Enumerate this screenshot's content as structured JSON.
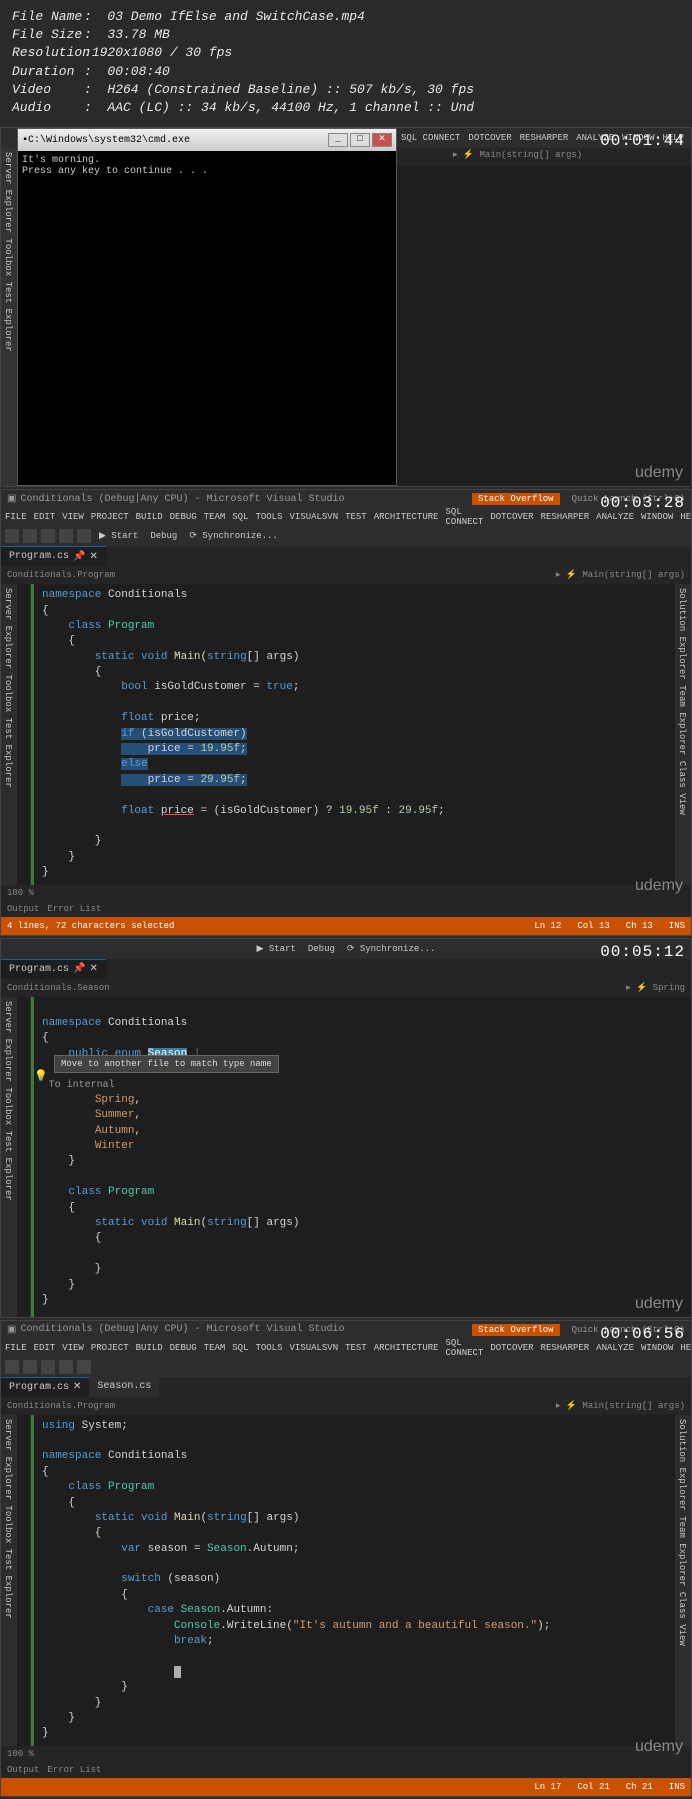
{
  "meta": {
    "file_name": {
      "label": "File Name",
      "value": "03 Demo IfElse and SwitchCase.mp4"
    },
    "file_size": {
      "label": "File Size",
      "value": "33.78 MB"
    },
    "resolution": {
      "label": "Resolution",
      "value": "1920x1080 / 30 fps"
    },
    "duration": {
      "label": "Duration",
      "value": "00:08:40"
    },
    "video": {
      "label": "Video",
      "value": "H264 (Constrained Baseline) :: 507 kb/s, 30 fps"
    },
    "audio": {
      "label": "Audio",
      "value": "AAC (LC) :: 34 kb/s, 44100 Hz, 1 channel :: Und"
    }
  },
  "timestamps": [
    "00:01:44",
    "00:03:28",
    "00:05:12",
    "00:06:56"
  ],
  "watermark": "udemy",
  "shot1": {
    "cmd_title": "C:\\Windows\\system32\\cmd.exe",
    "console_l1": "It's morning.",
    "console_l2": "Press any key to continue . . .",
    "menu": [
      "SQL CONNECT",
      "DOTCOVER",
      "RESHARPER",
      "ANALYZE",
      "WINDOW",
      "HELP"
    ],
    "nav": "▸ ⚡ Main(string[] args)",
    "side": "Server Explorer  Toolbox  Test Explorer"
  },
  "shot2": {
    "title": "Conditionals (Debug|Any CPU) - Microsoft Visual Studio",
    "so": "Stack Overflow",
    "ql": "Quick Launch (Ctrl+Q)",
    "menu": [
      "FILE",
      "EDIT",
      "VIEW",
      "PROJECT",
      "BUILD",
      "DEBUG",
      "TEAM",
      "SQL",
      "TOOLS",
      "VISUALSVN",
      "TEST",
      "ARCHITECTURE",
      "SQL CONNECT",
      "DOTCOVER",
      "RESHARPER",
      "ANALYZE",
      "WINDOW",
      "HELP"
    ],
    "tool": {
      "start": "▶ Start",
      "debug": "Debug",
      "sync": "⟳ Synchronize..."
    },
    "tab": "Program.cs",
    "tab_x": "✕",
    "nav_l": "Conditionals.Program",
    "nav_r": "⚡ Main(string[] args)",
    "lside": "Server Explorer  Toolbox  Test Explorer",
    "rside": "Solution Explorer  Team Explorer  Class View",
    "status_zoom": "100 %",
    "status": {
      "out": "Output",
      "err": "Error List"
    },
    "status2": {
      "sel": "4 lines, 72 characters selected",
      "ln": "Ln 12",
      "col": "Col 13",
      "ch": "Ch 13",
      "ins": "INS"
    },
    "code": {
      "l1": "namespace Conditionals",
      "l2": "{",
      "l3": "    class Program",
      "l4": "    {",
      "l5": "        static void Main(string[] args)",
      "l6": "        {",
      "l7": "            bool isGoldCustomer = true;",
      "l8": "",
      "l9": "            float price;",
      "l10": "            if (isGoldCustomer)",
      "l11": "                price = 19.95f;",
      "l12": "            else",
      "l13": "                price = 29.95f;",
      "l14": "",
      "l15": "            float price = (isGoldCustomer) ? 19.95f : 29.95f;",
      "l16": "",
      "l17": "        }",
      "l18": "    }",
      "l19": "}"
    }
  },
  "shot3": {
    "tool": {
      "start": "▶ Start",
      "debug": "Debug",
      "sync": "⟳ Synchronize..."
    },
    "tab": "Program.cs",
    "tab_x": "✕",
    "nav_l": "Conditionals.Season",
    "nav_r": "⚡ Spring",
    "lside": "Server Explorer  Toolbox  Test Explorer",
    "tooltip_text": "Move to another file to match type name",
    "tooltip_internal": "To internal",
    "code": {
      "l1": "namespace Conditionals",
      "l2": "{",
      "l3": "    public enum Season",
      "l4": "    {",
      "l5": "        Spring,",
      "l6": "        Summer,",
      "l7": "        Autumn,",
      "l8": "        Winter",
      "l9": "    }",
      "l10": "",
      "l11": "    class Program",
      "l12": "    {",
      "l13": "        static void Main(string[] args)",
      "l14": "        {",
      "l15": "",
      "l16": "        }",
      "l17": "    }",
      "l18": "}"
    }
  },
  "shot4": {
    "title": "Conditionals (Debug|Any CPU) - Microsoft Visual Studio",
    "so": "Stack Overflow",
    "ql": "Quick Launch (Ctrl+Q)",
    "menu": [
      "FILE",
      "EDIT",
      "VIEW",
      "PROJECT",
      "BUILD",
      "DEBUG",
      "TEAM",
      "SQL",
      "TOOLS",
      "VISUALSVN",
      "TEST",
      "ARCHITECTURE",
      "SQL CONNECT",
      "DOTCOVER",
      "RESHARPER",
      "ANALYZE",
      "WINDOW",
      "HELP"
    ],
    "tabs": [
      "Program.cs",
      "Season.cs"
    ],
    "nav_l": "Conditionals.Program",
    "nav_r": "⚡ Main(string[] args)",
    "lside": "Server Explorer  Toolbox  Test Explorer",
    "rside": "Solution Explorer  Team Explorer  Class View",
    "status_zoom": "100 %",
    "status": {
      "out": "Output",
      "err": "Error List"
    },
    "status2": {
      "ln": "Ln 17",
      "col": "Col 21",
      "ch": "Ch 21",
      "ins": "INS"
    },
    "code": {
      "l1": "using System;",
      "l2": "",
      "l3": "namespace Conditionals",
      "l4": "{",
      "l5": "    class Program",
      "l6": "    {",
      "l7": "        static void Main(string[] args)",
      "l8": "        {",
      "l9": "            var season = Season.Autumn;",
      "l10": "",
      "l11": "            switch (season)",
      "l12": "            {",
      "l13": "                case Season.Autumn:",
      "l14": "                    Console.WriteLine(\"It's autumn and a beautiful season.\");",
      "l15": "                    break;",
      "l16": "",
      "l17": "                    |",
      "l18": "            }",
      "l19": "        }",
      "l20": "    }",
      "l21": "}"
    }
  }
}
